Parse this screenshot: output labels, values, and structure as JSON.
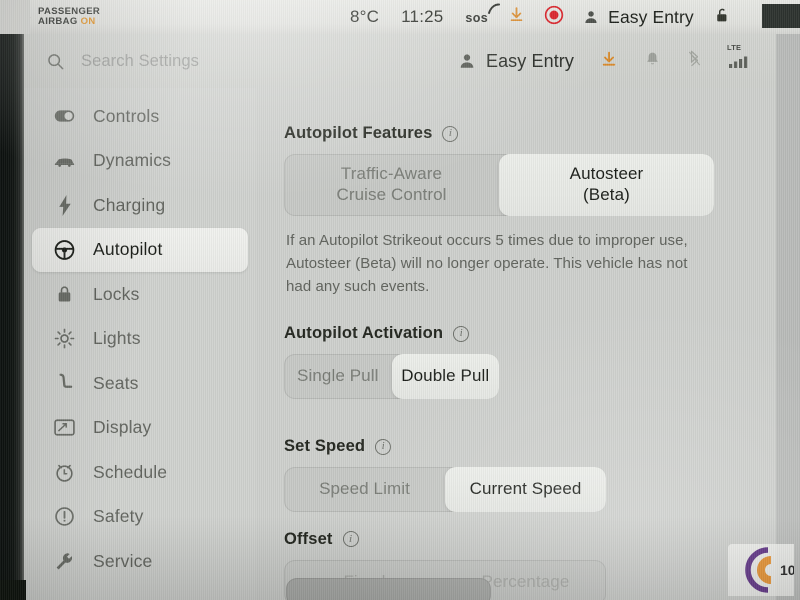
{
  "statusbar": {
    "airbag": {
      "icon": "passenger-airbag-off-icon",
      "line1": "PASSENGER",
      "line2": "AIRBAG",
      "state": "ON",
      "state_color": "#e2901f"
    },
    "temperature": "8°C",
    "time": "11:25",
    "sos_label": "sos",
    "record_icon": "record-circle-icon",
    "record_color": "#d81f26",
    "download_icon": "download-arrow-icon",
    "download_color": "#d98a2b",
    "profile_icon": "person-icon",
    "profile_name": "Easy Entry",
    "lock_icon": "unlocked-padlock-icon"
  },
  "appbar": {
    "search": {
      "icon": "search-icon",
      "placeholder": "Search Settings",
      "value": ""
    },
    "profile_icon": "person-icon",
    "profile_name": "Easy Entry",
    "download_icon": "download-arrow-icon",
    "download_color": "#d98a2b",
    "bell_icon": "bell-icon",
    "bluetooth_icon": "bluetooth-disabled-icon",
    "signal": {
      "label": "LTE",
      "icon": "signal-bars-icon",
      "bars": 4
    }
  },
  "sidebar": {
    "items": [
      {
        "label": "Controls",
        "icon": "toggle-switch-icon",
        "active": false
      },
      {
        "label": "Dynamics",
        "icon": "car-icon",
        "active": false
      },
      {
        "label": "Charging",
        "icon": "lightning-bolt-icon",
        "active": false
      },
      {
        "label": "Autopilot",
        "icon": "steering-wheel-icon",
        "active": true
      },
      {
        "label": "Locks",
        "icon": "padlock-icon",
        "active": false
      },
      {
        "label": "Lights",
        "icon": "brightness-sun-icon",
        "active": false
      },
      {
        "label": "Seats",
        "icon": "seat-icon",
        "active": false
      },
      {
        "label": "Display",
        "icon": "display-screen-icon",
        "active": false
      },
      {
        "label": "Schedule",
        "icon": "alarm-clock-icon",
        "active": false
      },
      {
        "label": "Safety",
        "icon": "warning-circle-icon",
        "active": false
      },
      {
        "label": "Service",
        "icon": "wrench-icon",
        "active": false
      }
    ]
  },
  "content": {
    "autopilot_features": {
      "title": "Autopilot Features",
      "info_icon": "info-icon",
      "options": [
        {
          "label": "Traffic-Aware\nCruise Control",
          "line1": "Traffic-Aware",
          "line2": "Cruise Control",
          "selected": false
        },
        {
          "label": "Autosteer\n(Beta)",
          "line1": "Autosteer",
          "line2": "(Beta)",
          "selected": true
        }
      ],
      "description": "If an Autopilot Strikeout occurs 5 times due to improper use, Autosteer (Beta) will no longer operate. This vehicle has not had any such events."
    },
    "autopilot_activation": {
      "title": "Autopilot Activation",
      "info_icon": "info-icon",
      "options": [
        {
          "label": "Single Pull",
          "selected": false
        },
        {
          "label": "Double Pull",
          "selected": true
        }
      ]
    },
    "set_speed": {
      "title": "Set Speed",
      "info_icon": "info-icon",
      "options": [
        {
          "label": "Speed Limit",
          "selected": false
        },
        {
          "label": "Current Speed",
          "selected": true
        }
      ]
    },
    "offset": {
      "title": "Offset",
      "info_icon": "info-icon",
      "options": [
        {
          "label": "Fixed",
          "selected": false,
          "dimmed": true
        },
        {
          "label": "Percentage",
          "selected": false,
          "dimmed": true
        }
      ]
    }
  },
  "watermark": {
    "text": "10",
    "ring_color": "#5a2c82",
    "dot_color": "#e8902c"
  }
}
